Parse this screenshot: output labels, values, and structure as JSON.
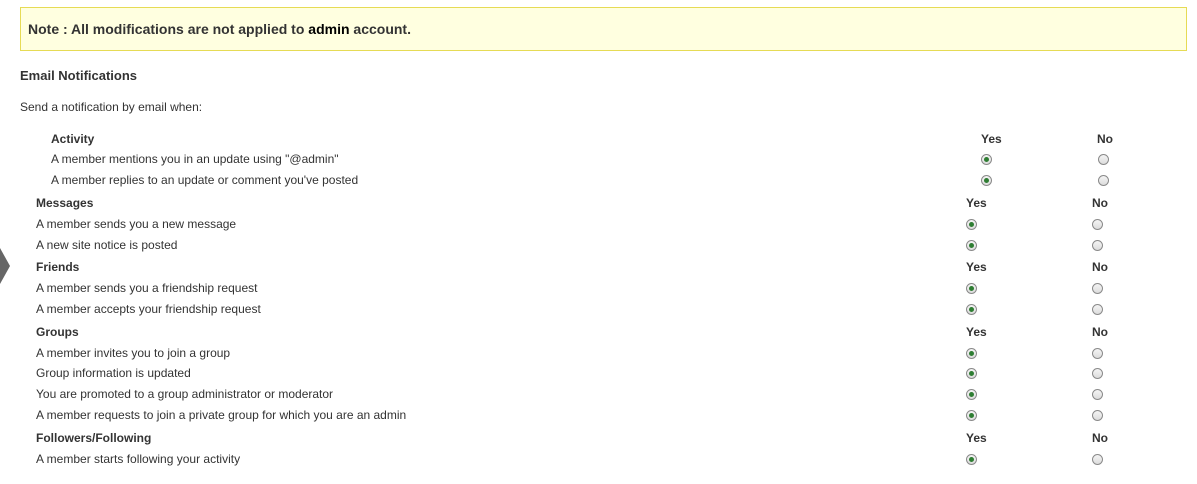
{
  "note": {
    "prefix": "Note : All modifications are not applied to ",
    "bold": "admin",
    "suffix": " account."
  },
  "section_title": "Email Notifications",
  "intro": "Send a notification by email when:",
  "columns": {
    "yes": "Yes",
    "no": "No"
  },
  "groups": {
    "activity": {
      "heading": "Activity",
      "items": [
        {
          "label": "A member mentions you in an update using \"@admin\"",
          "value": "Yes"
        },
        {
          "label": "A member replies to an update or comment you've posted",
          "value": "Yes"
        }
      ]
    },
    "messages": {
      "heading": "Messages",
      "items": [
        {
          "label": "A member sends you a new message",
          "value": "Yes"
        },
        {
          "label": "A new site notice is posted",
          "value": "Yes"
        }
      ]
    },
    "friends": {
      "heading": "Friends",
      "items": [
        {
          "label": "A member sends you a friendship request",
          "value": "Yes"
        },
        {
          "label": "A member accepts your friendship request",
          "value": "Yes"
        }
      ]
    },
    "groups": {
      "heading": "Groups",
      "items": [
        {
          "label": "A member invites you to join a group",
          "value": "Yes"
        },
        {
          "label": "Group information is updated",
          "value": "Yes"
        },
        {
          "label": "You are promoted to a group administrator or moderator",
          "value": "Yes"
        },
        {
          "label": "A member requests to join a private group for which you are an admin",
          "value": "Yes"
        }
      ]
    },
    "followers": {
      "heading": "Followers/Following",
      "items": [
        {
          "label": "A member starts following your activity",
          "value": "Yes"
        }
      ]
    }
  }
}
